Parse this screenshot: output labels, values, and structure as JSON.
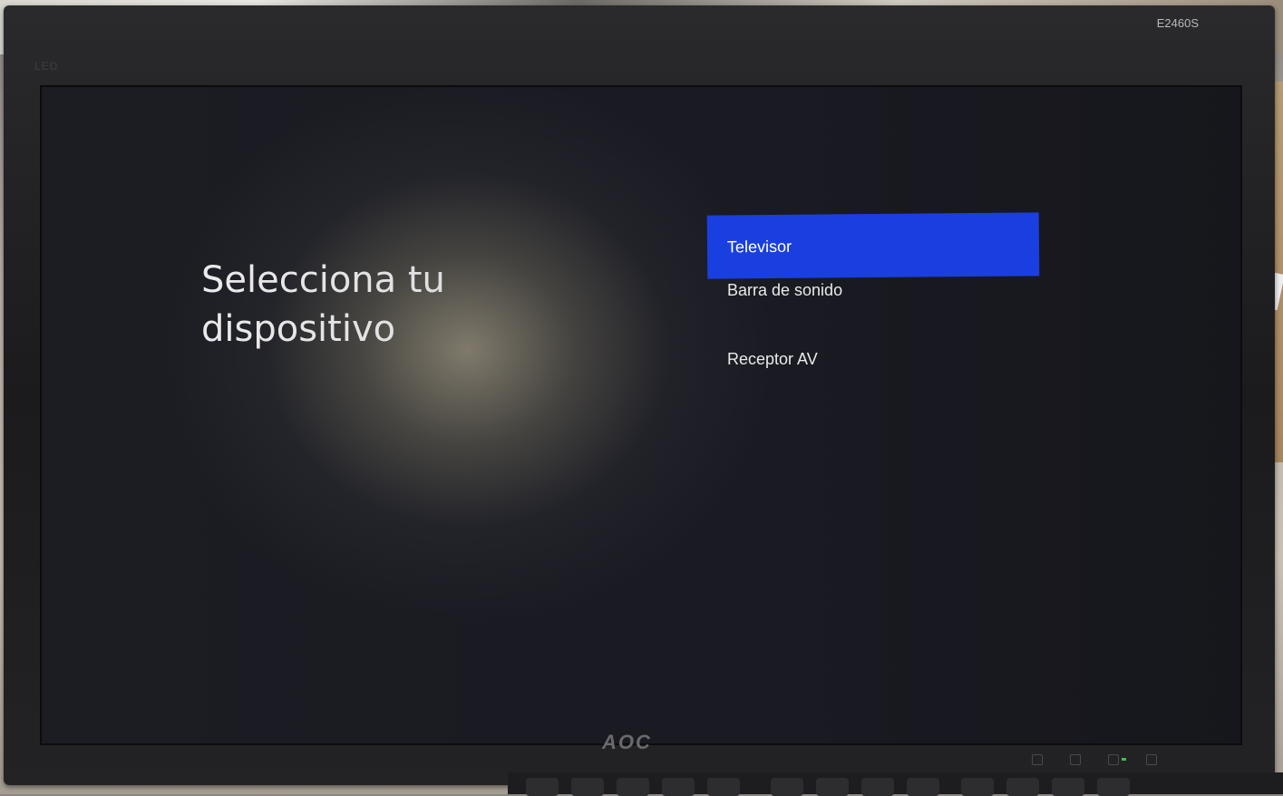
{
  "monitor": {
    "model": "E2460S",
    "panel_label": "LED",
    "brand": "AOC"
  },
  "screen": {
    "title": "Selecciona tu dispositivo",
    "options": [
      {
        "label": "Televisor",
        "selected": true
      },
      {
        "label": "Barra de sonido",
        "selected": false
      },
      {
        "label": "Receptor AV",
        "selected": false
      }
    ]
  },
  "colors": {
    "accent": "#1a3fe0",
    "screen_bg": "#1f2026",
    "text": "#f2f2f2"
  }
}
